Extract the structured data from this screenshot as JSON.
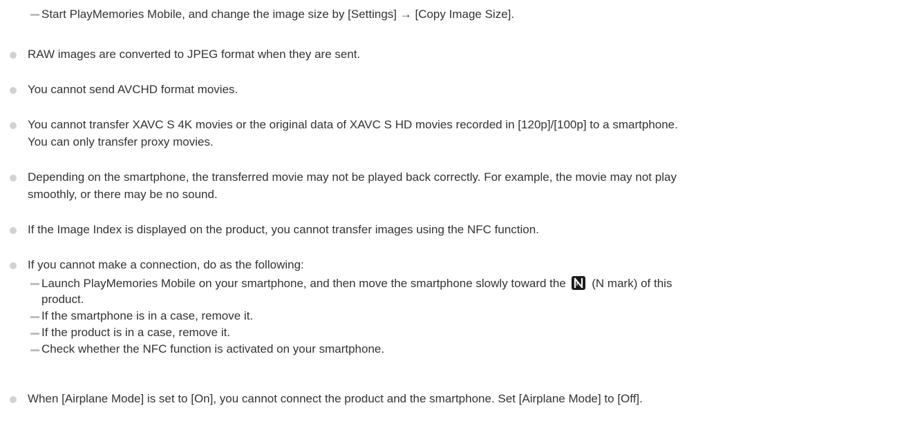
{
  "notes": {
    "top_sub_item": "Start PlayMemories Mobile, and change the image size by [Settings] → [Copy Image Size].",
    "raw_note": "RAW images are converted to JPEG format when they are sent.",
    "avchd_note": "You cannot send AVCHD format movies.",
    "xavc_note": {
      "line1": "You cannot transfer XAVC S 4K movies or the original data of XAVC S HD movies recorded in [120p]/[100p] to a smartphone.",
      "line2": "You can only transfer proxy movies."
    },
    "playback_note": {
      "line1": "Depending on the smartphone, the transferred movie may not be played back correctly. For example, the movie may not play",
      "line2": "smoothly, or there may be no sound."
    },
    "image_index_note": "If the Image Index is displayed on the product, you cannot transfer images using the NFC function.",
    "connection_note": {
      "intro": "If you cannot make a connection, do as the following:",
      "step1_before_icon": "Launch PlayMemories Mobile on your smartphone, and then move the smartphone slowly toward the",
      "step1_after_icon": "(N mark) of this",
      "step1_line2": "product.",
      "step2": "If the smartphone is in a case, remove it.",
      "step3": "If the product is in a case, remove it.",
      "step4": "Check whether the NFC function is activated on your smartphone."
    },
    "airplane_note": "When [Airplane Mode] is set to [On], you cannot connect the product and the smartphone. Set [Airplane Mode] to [Off]."
  },
  "icons": {
    "bullet": "circle-bullet",
    "sub_item_marker": "dash",
    "nfc": "n-mark-icon"
  },
  "colors": {
    "text": "#333333",
    "bullet": "#d2d2d2",
    "dash": "#bdbdbd",
    "nfc_icon": "#1a1a1a"
  }
}
